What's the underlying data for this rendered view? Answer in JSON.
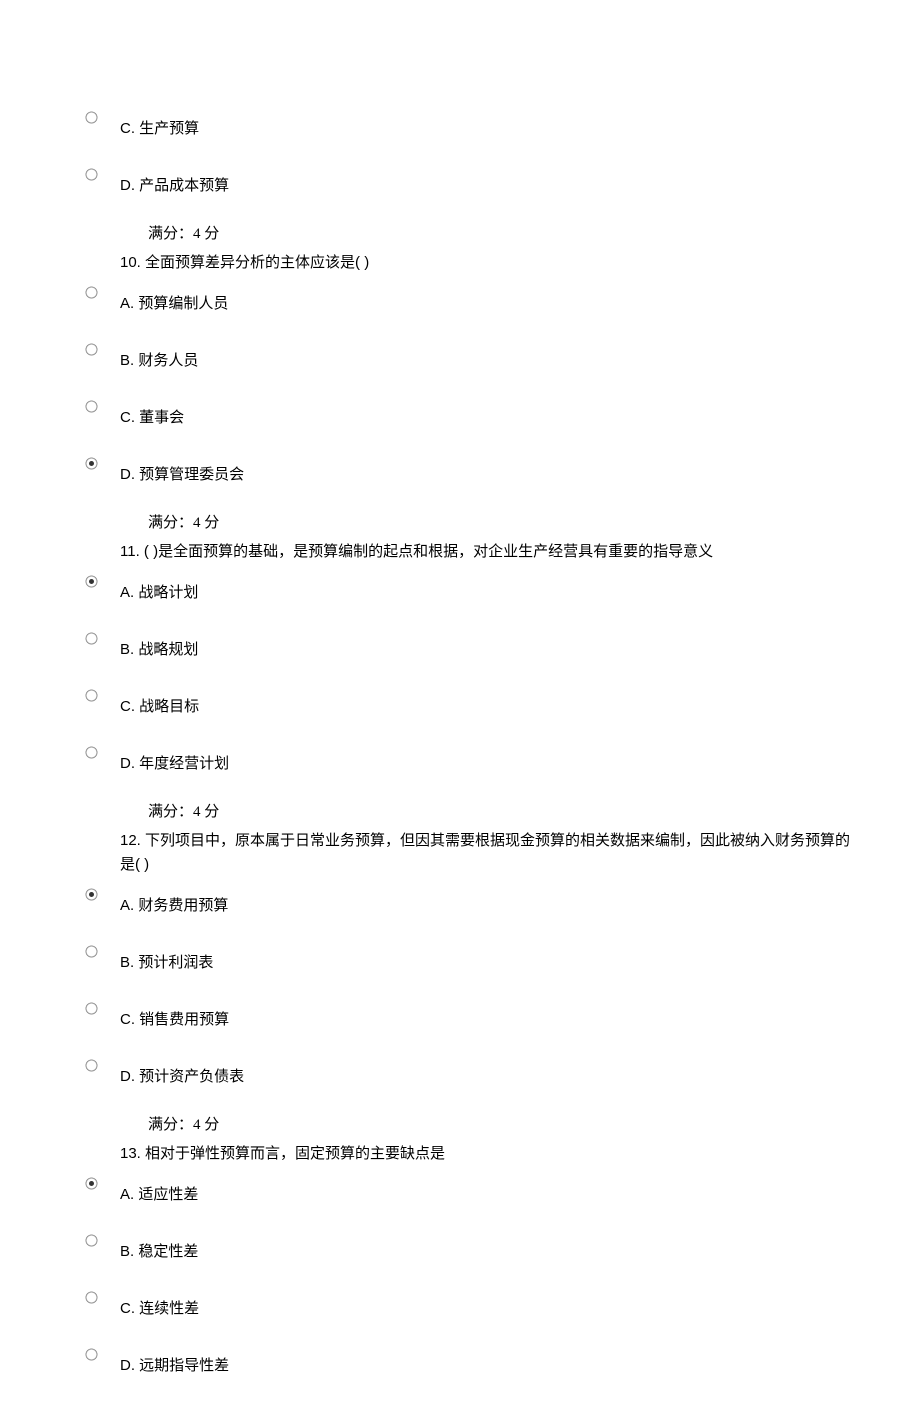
{
  "orphan_options": [
    {
      "letter": "C.",
      "text": "生产预算",
      "selected": false
    },
    {
      "letter": "D.",
      "text": "产品成本预算",
      "selected": false
    }
  ],
  "questions": [
    {
      "score": "满分：4 分",
      "number": "10.",
      "text": "全面预算差异分析的主体应该是( )",
      "options": [
        {
          "letter": "A.",
          "text": "预算编制人员",
          "selected": false
        },
        {
          "letter": "B.",
          "text": "财务人员",
          "selected": false
        },
        {
          "letter": "C.",
          "text": "董事会",
          "selected": false
        },
        {
          "letter": "D.",
          "text": "预算管理委员会",
          "selected": true
        }
      ]
    },
    {
      "score": "满分：4 分",
      "number": "11.",
      "text": "( )是全面预算的基础，是预算编制的起点和根据，对企业生产经营具有重要的指导意义",
      "options": [
        {
          "letter": "A.",
          "text": "战略计划",
          "selected": true
        },
        {
          "letter": "B.",
          "text": "战略规划",
          "selected": false
        },
        {
          "letter": "C.",
          "text": "战略目标",
          "selected": false
        },
        {
          "letter": "D.",
          "text": "年度经营计划",
          "selected": false
        }
      ]
    },
    {
      "score": "满分：4 分",
      "number": "12.",
      "text": "下列项目中，原本属于日常业务预算，但因其需要根据现金预算的相关数据来编制，因此被纳入财务预算的是( )",
      "options": [
        {
          "letter": "A.",
          "text": "财务费用预算",
          "selected": true
        },
        {
          "letter": "B.",
          "text": "预计利润表",
          "selected": false
        },
        {
          "letter": "C.",
          "text": "销售费用预算",
          "selected": false
        },
        {
          "letter": "D.",
          "text": "预计资产负债表",
          "selected": false
        }
      ]
    },
    {
      "score": "满分：4 分",
      "number": "13.",
      "text": "相对于弹性预算而言，固定预算的主要缺点是",
      "options": [
        {
          "letter": "A.",
          "text": "适应性差",
          "selected": true
        },
        {
          "letter": "B.",
          "text": "稳定性差",
          "selected": false
        },
        {
          "letter": "C.",
          "text": "连续性差",
          "selected": false
        },
        {
          "letter": "D.",
          "text": "远期指导性差",
          "selected": false
        }
      ]
    }
  ]
}
